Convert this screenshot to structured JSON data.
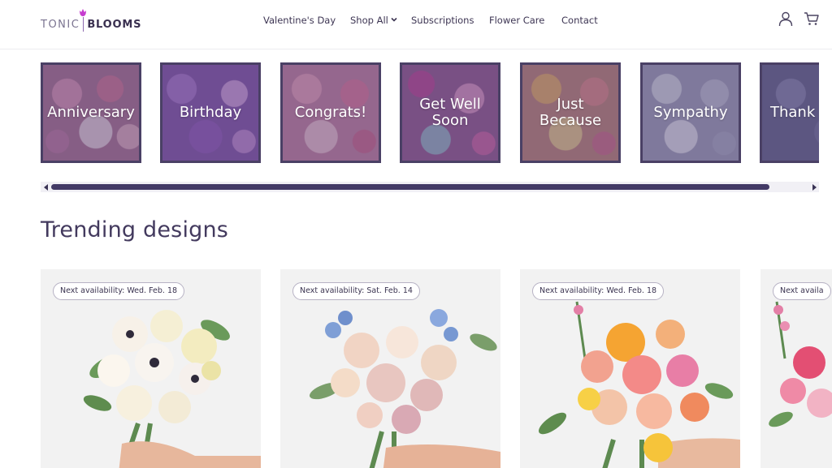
{
  "brand": {
    "name_left": "TONIC",
    "name_right": "BLOOMS",
    "accent_color": "#c63ccf"
  },
  "nav": {
    "items": [
      {
        "label": "Valentine's Day"
      },
      {
        "label": "Shop All",
        "has_dropdown": true
      },
      {
        "label": "Subscriptions"
      },
      {
        "label": "Flower Care"
      },
      {
        "label": "Contact"
      }
    ]
  },
  "header_icons": [
    "account-icon",
    "cart-icon"
  ],
  "occasions": [
    {
      "label": "Anniversary"
    },
    {
      "label": "Birthday"
    },
    {
      "label": "Congrats!"
    },
    {
      "label": "Get Well Soon"
    },
    {
      "label": "Just Because"
    },
    {
      "label": "Sympathy"
    },
    {
      "label": "Thank"
    }
  ],
  "trending": {
    "title": "Trending designs",
    "products": [
      {
        "availability": "Next availability: Wed. Feb. 18"
      },
      {
        "availability": "Next availability: Sat. Feb. 14"
      },
      {
        "availability": "Next availability: Wed. Feb. 18"
      },
      {
        "availability": "Next availa"
      }
    ]
  },
  "colors": {
    "tile_border": "#4a4065",
    "scroll_thumb": "#433a66",
    "text_primary": "#3d3553"
  }
}
